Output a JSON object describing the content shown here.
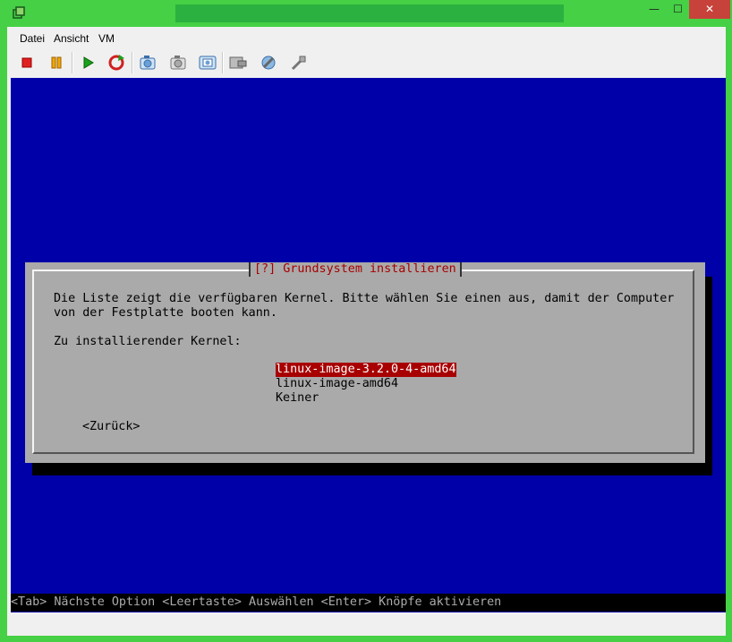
{
  "window": {
    "title": "",
    "colors": {
      "frame": "#45d045",
      "title_field": "#2ab140",
      "close": "#c7423a"
    }
  },
  "window_controls": {
    "minimize": "—",
    "maximize": "☐",
    "close": "✕"
  },
  "menu": {
    "file": "Datei",
    "view": "Ansicht",
    "vm": "VM"
  },
  "toolbar": {
    "buttons": [
      {
        "icon": "stop-icon",
        "color": "#e02020"
      },
      {
        "icon": "pause-icon",
        "color": "#e8a000"
      },
      {
        "icon": "play-icon",
        "color": "#1a9a1a"
      },
      {
        "icon": "reset-icon",
        "color": "#d02020"
      },
      {
        "icon": "snapshot-icon"
      },
      {
        "icon": "revert-snapshot-icon"
      },
      {
        "icon": "manage-snapshots-icon"
      },
      {
        "icon": "send-keys-icon"
      },
      {
        "icon": "settings-icon"
      },
      {
        "icon": "tools-icon"
      }
    ]
  },
  "installer": {
    "title": "[?] Grundsystem installieren",
    "description_line1": "Die Liste zeigt die verfügbaren Kernel. Bitte wählen Sie einen aus, damit der Computer",
    "description_line2": "von der Festplatte booten kann.",
    "prompt": "Zu installierender Kernel:",
    "options": [
      "linux-image-3.2.0-4-amd64",
      "linux-image-amd64",
      "Keiner"
    ],
    "selected_index": 0,
    "back_button": "<Zurück>",
    "hint": "<Tab> Nächste Option <Leertaste> Auswählen <Enter> Knöpfe aktivieren",
    "colors": {
      "screen": "#0000a8",
      "dialog": "#aaaaaa",
      "title": "#a80000",
      "selection": "#a80000"
    }
  }
}
